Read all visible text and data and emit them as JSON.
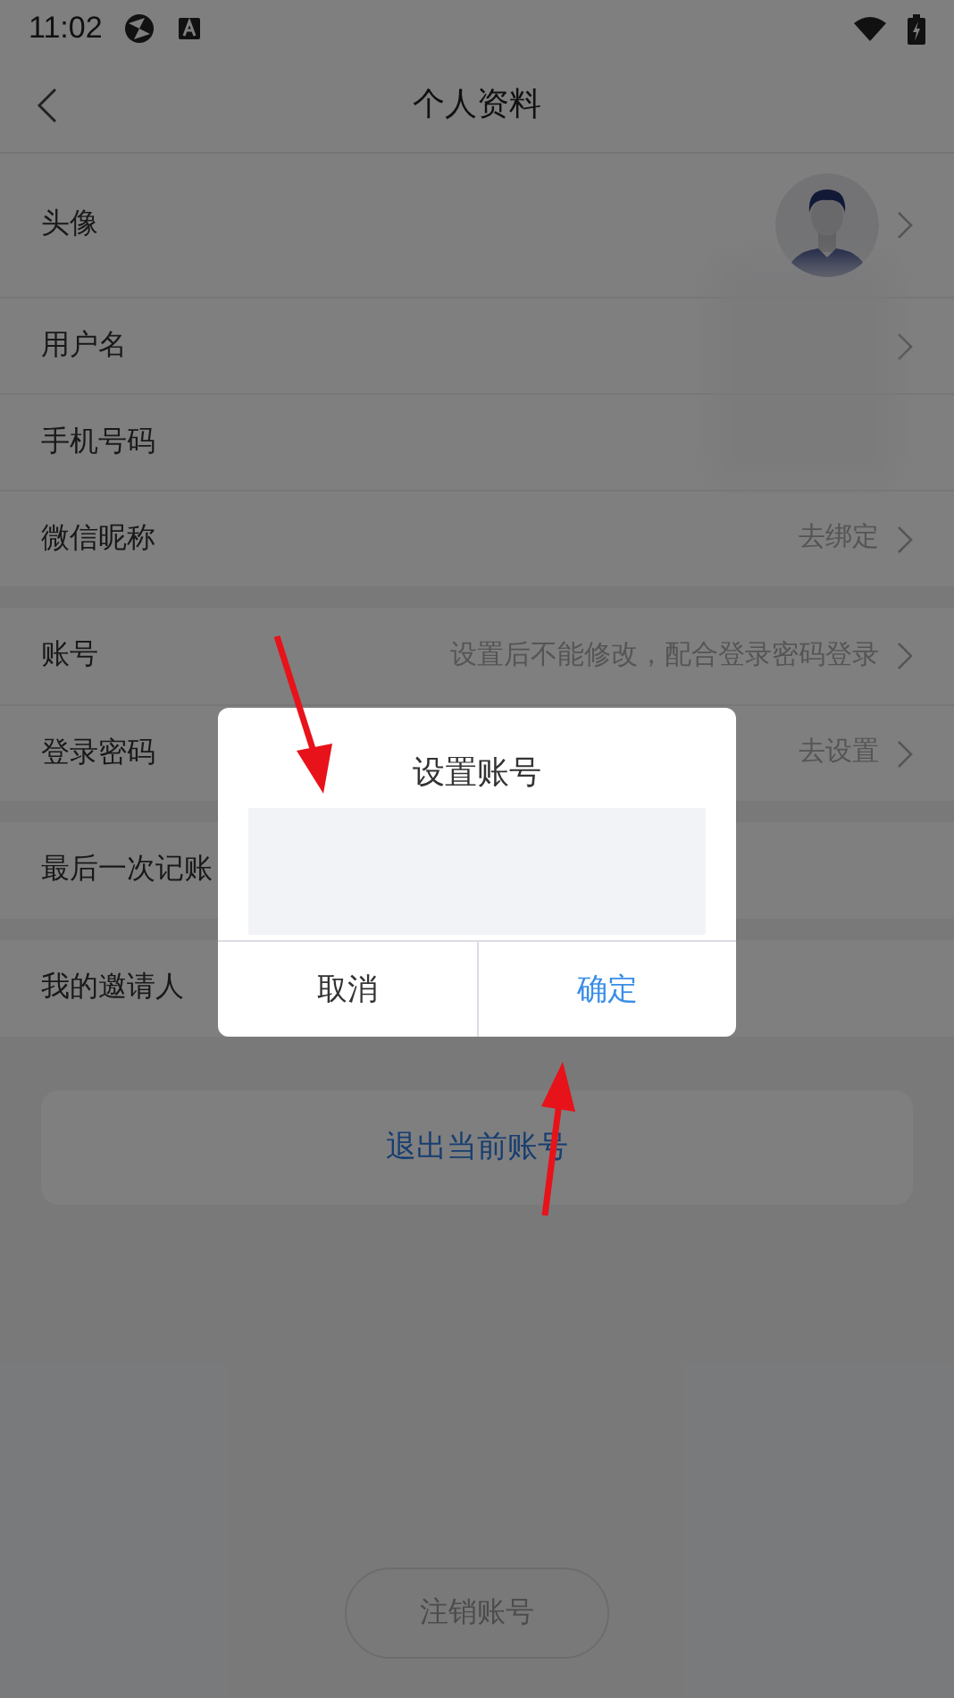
{
  "status_bar": {
    "time": "11:02"
  },
  "header": {
    "title": "个人资料"
  },
  "sections": [
    {
      "rows": [
        {
          "kind": "avatar",
          "label": "头像",
          "chevron": true
        },
        {
          "kind": "blurred",
          "label": "用户名",
          "chevron": true
        },
        {
          "kind": "blurred",
          "label": "手机号码",
          "chevron": false
        },
        {
          "kind": "text",
          "label": "微信昵称",
          "value": "去绑定",
          "chevron": true
        }
      ]
    },
    {
      "rows": [
        {
          "kind": "text",
          "label": "账号",
          "value": "设置后不能修改，配合登录密码登录",
          "chevron": true
        },
        {
          "kind": "text",
          "label": "登录密码",
          "value": "去设置",
          "chevron": true
        }
      ]
    },
    {
      "rows": [
        {
          "kind": "text",
          "label": "最后一次记账",
          "chevron": false
        }
      ]
    },
    {
      "rows": [
        {
          "kind": "text",
          "label": "我的邀请人",
          "chevron": false
        }
      ]
    }
  ],
  "logout_button": "退出当前账号",
  "delete_account_button": "注销账号",
  "dialog": {
    "title": "设置账号",
    "buttons": [
      {
        "kind": "cancel",
        "label": "取消"
      },
      {
        "kind": "confirm",
        "label": "确定"
      }
    ]
  }
}
